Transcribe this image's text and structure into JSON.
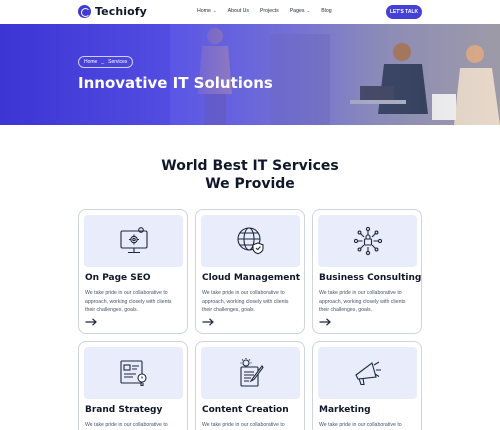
{
  "brand": {
    "name": "Techiofy",
    "accent": "#4440d8"
  },
  "nav": {
    "items": [
      {
        "label": "Home",
        "has_dropdown": true
      },
      {
        "label": "About Us",
        "has_dropdown": false
      },
      {
        "label": "Projects",
        "has_dropdown": false
      },
      {
        "label": "Pages",
        "has_dropdown": true
      },
      {
        "label": "Blog",
        "has_dropdown": false
      }
    ],
    "cta_label": "LET'S TALK"
  },
  "hero": {
    "breadcrumb": {
      "home": "Home",
      "separator": "_",
      "current": "Services"
    },
    "title": "Innovative IT Solutions"
  },
  "section": {
    "title_line1": "World Best IT Services",
    "title_line2": "We Provide"
  },
  "services": [
    {
      "title": "On Page SEO",
      "icon": "monitor-gear-icon",
      "desc": "We take pride in our collaborative to approach, working closely with clients their challenges, goals."
    },
    {
      "title": "Cloud Management",
      "icon": "globe-shield-icon",
      "desc": "We take pride in our collaborative to approach, working closely with clients their challenges, goals."
    },
    {
      "title": "Business Consulting",
      "icon": "network-lock-icon",
      "desc": "We take pride in our collaborative to approach, working closely with clients their challenges, goals."
    },
    {
      "title": "Brand Strategy",
      "icon": "strategy-board-icon",
      "desc": "We take pride in our collaborative to approach, working closely with clients their challenges, goals."
    },
    {
      "title": "Content Creation",
      "icon": "content-edit-icon",
      "desc": "We take pride in our collaborative to approach, working closely with clients their challenges, goals."
    },
    {
      "title": "Marketing",
      "icon": "megaphone-icon",
      "desc": "We take pride in our collaborative to approach, working closely with clients their challenges, goals."
    }
  ]
}
